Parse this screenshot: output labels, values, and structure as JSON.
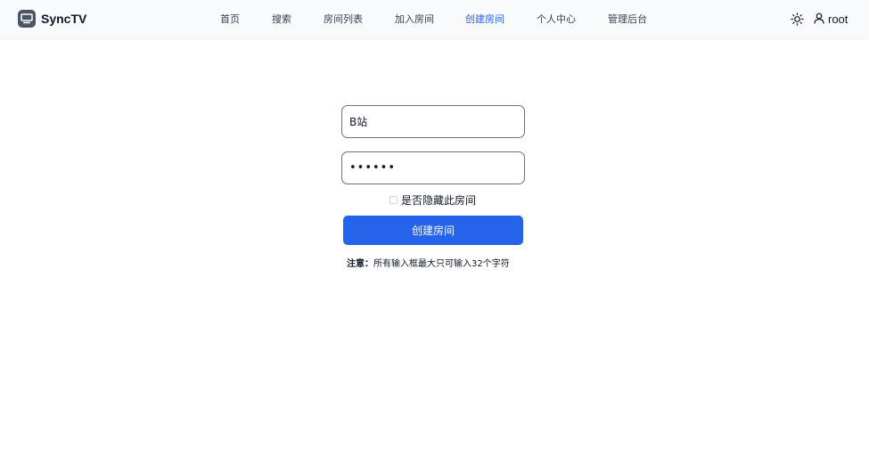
{
  "navbar": {
    "brand": "SyncTV",
    "links": [
      {
        "label": "首页",
        "active": false
      },
      {
        "label": "搜索",
        "active": false
      },
      {
        "label": "房间列表",
        "active": false
      },
      {
        "label": "加入房间",
        "active": false
      },
      {
        "label": "创建房间",
        "active": true
      },
      {
        "label": "个人中心",
        "active": false
      },
      {
        "label": "管理后台",
        "active": false
      }
    ],
    "theme_icon": "sun-icon",
    "user": {
      "icon": "user-icon",
      "name": "root"
    }
  },
  "form": {
    "room_name_value": "B站",
    "password_value": "••••••",
    "hidden_checked": false,
    "hidden_label": "是否隐藏此房间",
    "submit_label": "创建房间",
    "note_prefix": "注意：",
    "note_text": "所有输入框最大只可输入32个字符"
  },
  "colors": {
    "accent": "#2563eb",
    "navbar_bg": "#f8fafc",
    "text": "#111827"
  }
}
